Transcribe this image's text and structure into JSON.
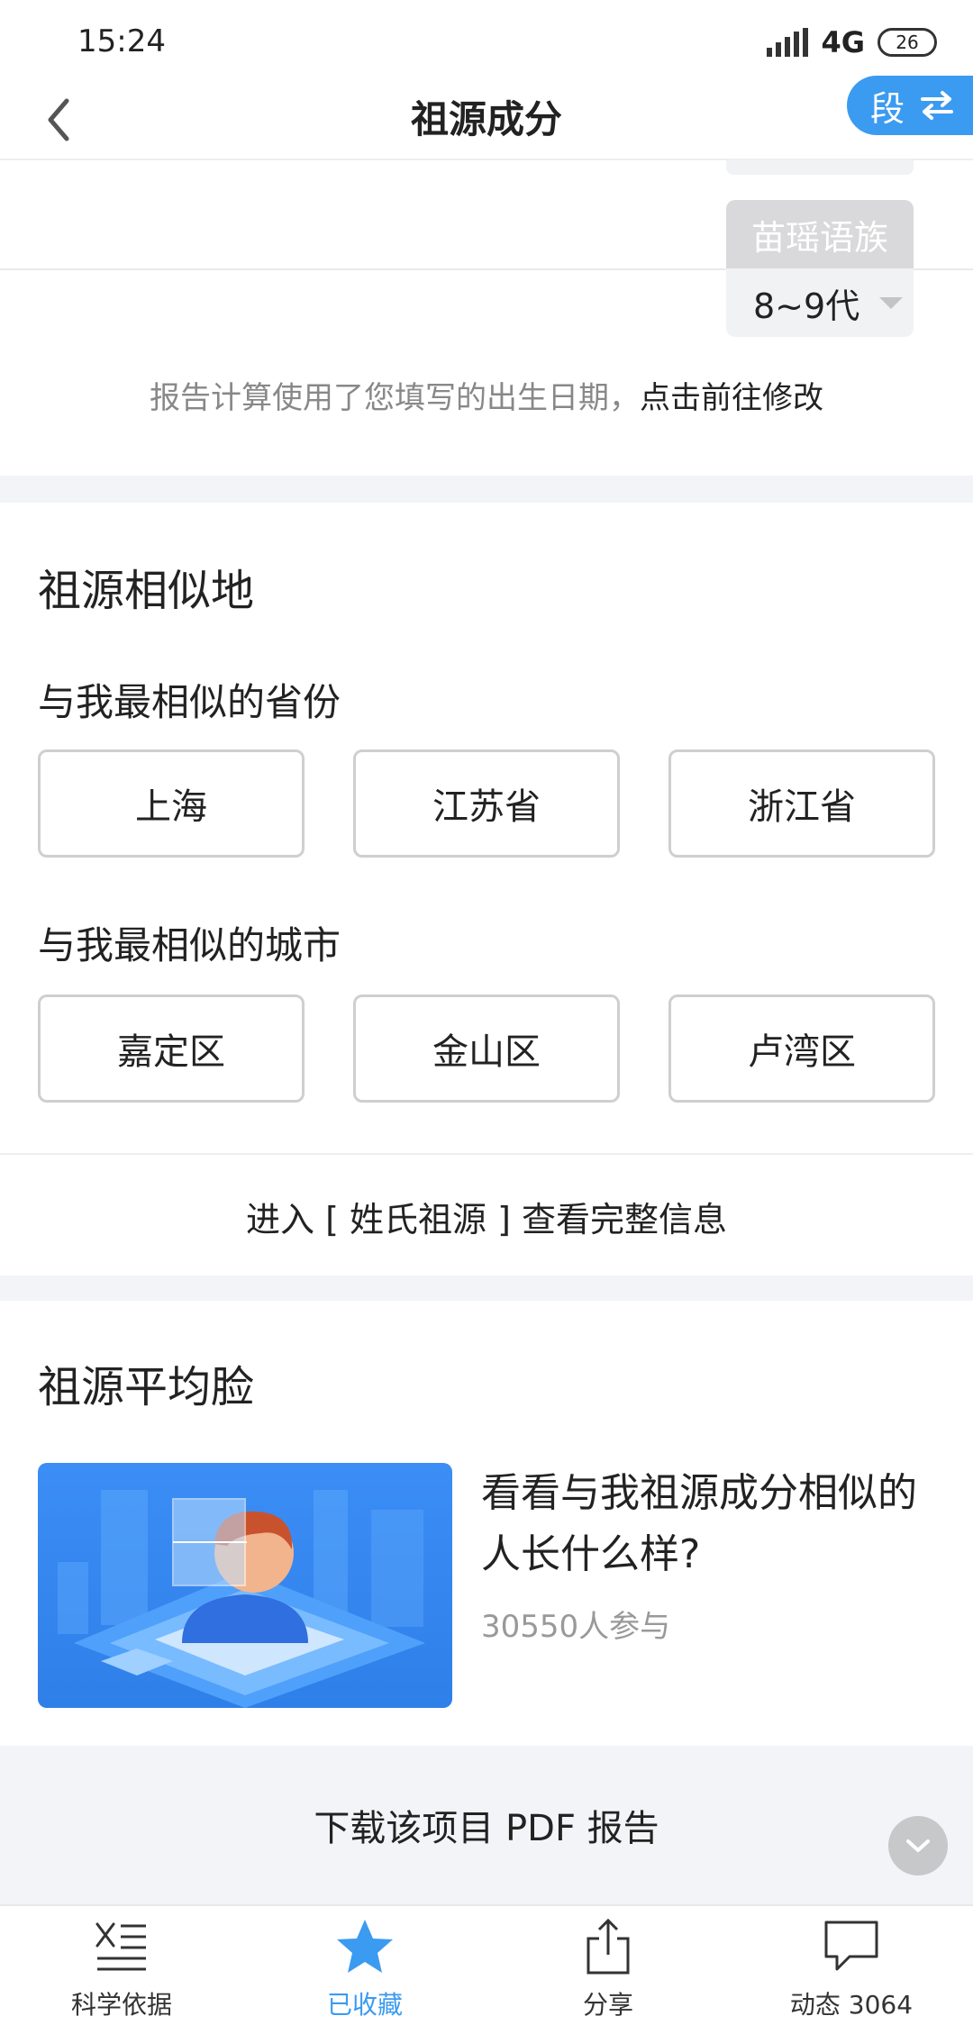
{
  "status_bar": {
    "time": "15:24",
    "network": "4G",
    "battery": "26"
  },
  "header": {
    "title": "祖源成分",
    "switch_label": "段"
  },
  "top": {
    "ethnic_group": "苗瑶语族",
    "generation": "8~9代",
    "notice_prefix": "报告计算使用了您填写的出生日期，",
    "notice_link": "点击前往修改"
  },
  "places": {
    "title": "祖源相似地",
    "province_subtitle": "与我最相似的省份",
    "provinces": [
      "上海",
      "江苏省",
      "浙江省"
    ],
    "city_subtitle": "与我最相似的城市",
    "cities": [
      "嘉定区",
      "金山区",
      "卢湾区"
    ],
    "surname_link": "进入 [ 姓氏祖源 ] 查看完整信息"
  },
  "face": {
    "title": "祖源平均脸",
    "headline": "看看与我祖源成分相似的人长什么样?",
    "participants": "30550人参与"
  },
  "pdf": {
    "label": "下载该项目 PDF 报告"
  },
  "bottom_nav": [
    {
      "label": "科学依据",
      "icon": "science-basis-icon",
      "active": false
    },
    {
      "label": "已收藏",
      "icon": "star-icon",
      "active": true
    },
    {
      "label": "分享",
      "icon": "share-icon",
      "active": false
    },
    {
      "label": "动态 3064",
      "icon": "comment-icon",
      "active": false
    }
  ],
  "colors": {
    "accent": "#3b9bf0",
    "band": "#f2f4f7",
    "muted_text": "#888888"
  }
}
